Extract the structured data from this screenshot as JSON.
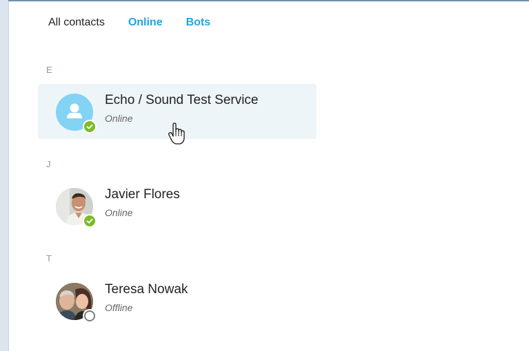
{
  "tabs": [
    {
      "label": "All contacts",
      "active": true
    },
    {
      "label": "Online",
      "active": false
    },
    {
      "label": "Bots",
      "active": false
    }
  ],
  "sections": [
    {
      "letter": "E",
      "contacts": [
        {
          "name": "Echo / Sound Test Service",
          "status": "Online",
          "presence": "online",
          "avatar": "default-avatar",
          "hovered": true
        }
      ]
    },
    {
      "letter": "J",
      "contacts": [
        {
          "name": "Javier Flores",
          "status": "Online",
          "presence": "online",
          "avatar": "photo",
          "hovered": false
        }
      ]
    },
    {
      "letter": "T",
      "contacts": [
        {
          "name": "Teresa Nowak",
          "status": "Offline",
          "presence": "offline",
          "avatar": "photo",
          "hovered": false
        }
      ]
    }
  ],
  "colors": {
    "accent": "#1ea5e0",
    "online": "#7cbb29",
    "offline_ring": "#7b7b7b",
    "hover_bg": "#eef5f9",
    "section_letter": "#8a97a6"
  },
  "icons": {
    "cursor": "hand-pointer-icon",
    "presence_online": "checkmark-icon",
    "default_avatar": "person-icon"
  }
}
